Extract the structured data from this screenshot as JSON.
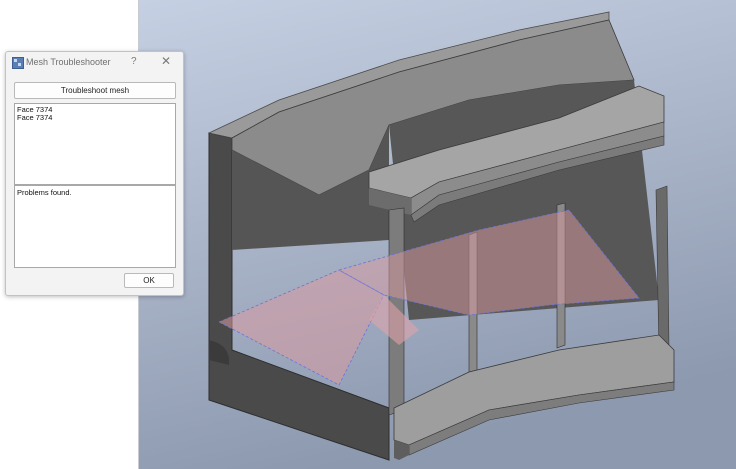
{
  "dialog": {
    "title": "Mesh Troubleshooter",
    "help_label": "?",
    "close_label": "✕",
    "troubleshoot_label": "Troubleshoot mesh",
    "faces": [
      "Face 7374",
      "Face 7374"
    ],
    "problems_text": "Problems found.",
    "ok_label": "OK",
    "icon": "mesh-app-icon"
  },
  "viewport": {
    "background_top": "#c4cfe2",
    "background_bottom": "#8f9bb1",
    "highlight_color": "#d99aa0",
    "highlight_edge_color": "#6b74d6"
  }
}
